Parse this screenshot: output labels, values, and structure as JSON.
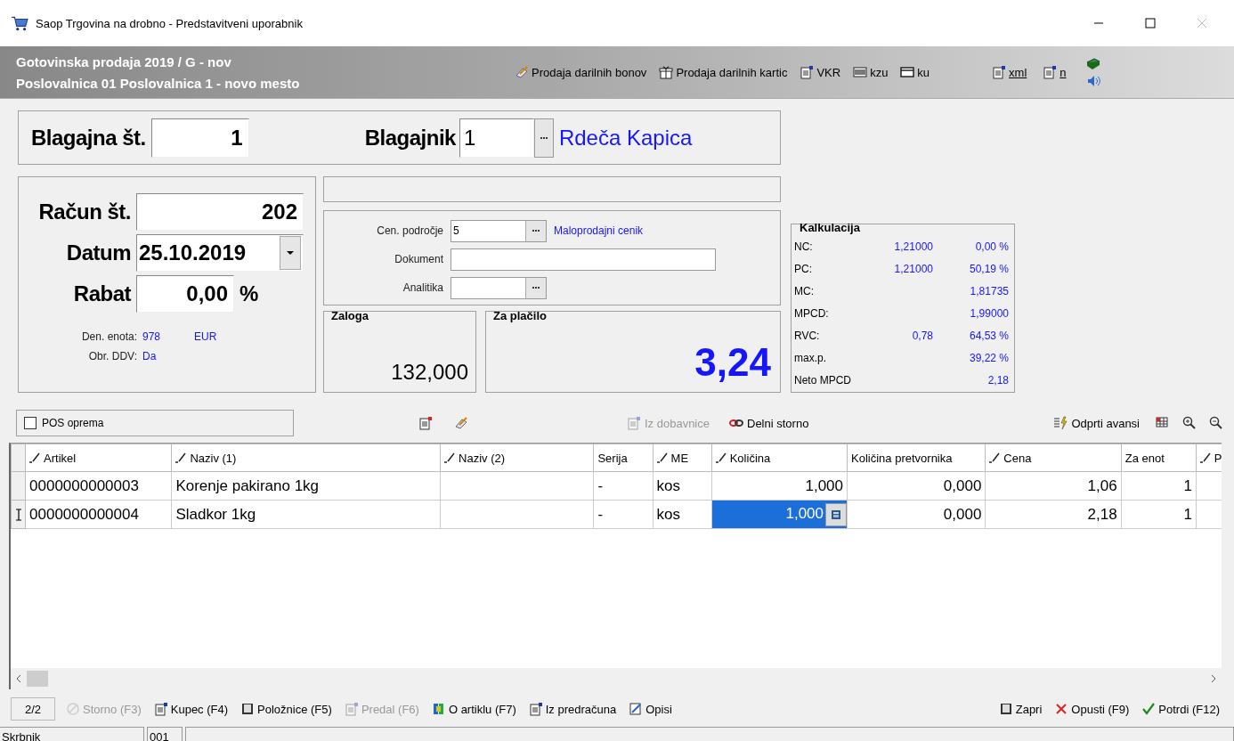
{
  "window": {
    "title": "Saop Trgovina na drobno - Predstavitveni uporabnik"
  },
  "header": {
    "lines": [
      "Gotovinska prodaja 2019 / G - nov",
      "Poslovalnica 01 Poslovalnica 1 - novo mesto"
    ],
    "actions": [
      {
        "label": "Prodaja darilnih bonov",
        "kind": "voucher"
      },
      {
        "label": "Prodaja darilnih kartic",
        "kind": "gift"
      },
      {
        "label": "VKR",
        "kind": "doc"
      },
      {
        "label": "kzu",
        "kind": "barcode"
      },
      {
        "label": "ku",
        "kind": "card"
      }
    ],
    "links": [
      {
        "label": "xml",
        "kind": "doc"
      },
      {
        "label": "n",
        "kind": "doc"
      }
    ]
  },
  "register": {
    "label": "Blagajna št.",
    "value": "1"
  },
  "cashier": {
    "label": "Blagajnik",
    "value": "1",
    "name": "Rdeča Kapica"
  },
  "invoice": {
    "fields": [
      {
        "label": "Račun št.",
        "value": "202",
        "kind": "text"
      },
      {
        "label": "Datum",
        "value": "25.10.2019",
        "kind": "date"
      },
      {
        "label": "Rabat",
        "value": "0,00",
        "unit": "%",
        "kind": "percent"
      }
    ],
    "currency": {
      "label": "Den. enota:",
      "code": "978",
      "name": "EUR"
    },
    "vat": {
      "label": "Obr. DDV:",
      "value": "Da"
    }
  },
  "params": [
    {
      "label": "Cen. področje",
      "value": "5",
      "kind": "lookup",
      "note": "Maloprodajni cenik"
    },
    {
      "label": "Dokument",
      "kind": "text"
    },
    {
      "label": "Analitika",
      "kind": "lookup"
    }
  ],
  "stock": {
    "title": "Zaloga",
    "value": "132,000"
  },
  "to_pay": {
    "title": "Za plačilo",
    "value": "3,24"
  },
  "calculation": {
    "title": "Kalkulacija",
    "rows": [
      {
        "label": "NC:",
        "value_1": "1,21000",
        "value_2": "0,00 %"
      },
      {
        "label": "PC:",
        "value_1": "1,21000",
        "value_2": "50,19 %"
      },
      {
        "label": "MC:",
        "value_1": "",
        "value_2": "1,81735"
      },
      {
        "label": "MPCD:",
        "value_1": "",
        "value_2": "1,99000"
      },
      {
        "label": "RVC:",
        "value_1": "0,78",
        "value_2": "64,53 %"
      },
      {
        "label": "max.p.",
        "value_1": "",
        "value_2": "39,22 %"
      },
      {
        "label": "Neto MPCD",
        "value_1": "",
        "value_2": "2,18"
      }
    ]
  },
  "toolbar": {
    "pos_equipment": {
      "label": "POS oprema",
      "checked": false
    },
    "actions": [
      {
        "label": "Iz dobavnice",
        "kind": "doc",
        "disabled": true
      },
      {
        "label": "Delni storno",
        "kind": "link",
        "disabled": false
      }
    ],
    "advances": {
      "label": "Odprti avansi"
    }
  },
  "table": {
    "columns": [
      {
        "label": "Artikel",
        "editable": true
      },
      {
        "label": "Naziv (1)",
        "editable": true
      },
      {
        "label": "Naziv (2)",
        "editable": true
      },
      {
        "label": "Serija",
        "editable": false
      },
      {
        "label": "ME",
        "editable": true
      },
      {
        "label": "Količina",
        "editable": true
      },
      {
        "label": "Količina pretvornika",
        "editable": false
      },
      {
        "label": "Cena",
        "editable": true
      },
      {
        "label": "Za enot",
        "editable": false
      },
      {
        "label": "P",
        "editable": true
      }
    ],
    "rows": [
      {
        "selected": false,
        "cells": [
          "0000000000003",
          "Korenje pakirano 1kg",
          "",
          "-",
          "kos",
          "1,000",
          "0,000",
          "1,06",
          "1",
          ""
        ]
      },
      {
        "selected": true,
        "cells": [
          "0000000000004",
          "Sladkor 1kg",
          "",
          "-",
          "kos",
          "1,000",
          "0,000",
          "2,18",
          "1",
          ""
        ]
      }
    ]
  },
  "footer": {
    "pager": "2/2",
    "actions": [
      {
        "label": "Storno (F3)",
        "kind": "cancel",
        "disabled": true
      },
      {
        "label": "Kupec (F4)",
        "kind": "doc",
        "disabled": false
      },
      {
        "label": "Položnice (F5)",
        "kind": "book",
        "disabled": false
      },
      {
        "label": "Predal (F6)",
        "kind": "doc",
        "disabled": true
      },
      {
        "label": "O artiklu (F7)",
        "kind": "info",
        "disabled": false
      },
      {
        "label": "Iz predračuna",
        "kind": "doc",
        "disabled": false
      },
      {
        "label": "Opisi",
        "kind": "edit",
        "disabled": false
      }
    ],
    "right_actions": [
      {
        "label": "Zapri",
        "kind": "book",
        "disabled": false
      },
      {
        "label": "Opusti (F9)",
        "kind": "cross",
        "disabled": false
      },
      {
        "label": "Potrdi (F12)",
        "kind": "tick",
        "disabled": false
      }
    ]
  },
  "status_bar": [
    "Skrbnik",
    "001"
  ]
}
